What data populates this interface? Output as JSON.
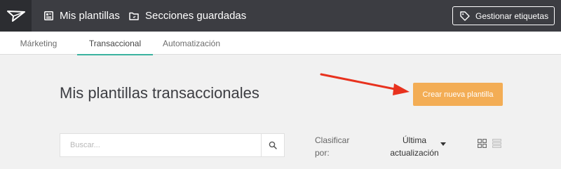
{
  "header": {
    "logo_icon": "paper-plane-icon",
    "nav": [
      {
        "label": "Mis plantillas",
        "icon": "template-icon"
      },
      {
        "label": "Secciones guardadas",
        "icon": "folder-icon"
      }
    ],
    "tags_button": {
      "label": "Gestionar etiquetas",
      "icon": "tag-icon"
    }
  },
  "tabs": [
    {
      "label": "Márketing",
      "active": false
    },
    {
      "label": "Transaccional",
      "active": true
    },
    {
      "label": "Automatización",
      "active": false
    }
  ],
  "main": {
    "title": "Mis plantillas transaccionales",
    "create_button": "Crear nueva plantilla",
    "search": {
      "placeholder": "Buscar..."
    },
    "sort": {
      "label_line1": "Clasificar",
      "label_line2": "por:",
      "value_line1": "Última",
      "value_line2": "actualización"
    }
  },
  "colors": {
    "topbar": "#3c3d42",
    "accent_tab": "#3bb3a0",
    "create_button": "#f3ad55",
    "annotation_arrow": "#e8321e"
  }
}
